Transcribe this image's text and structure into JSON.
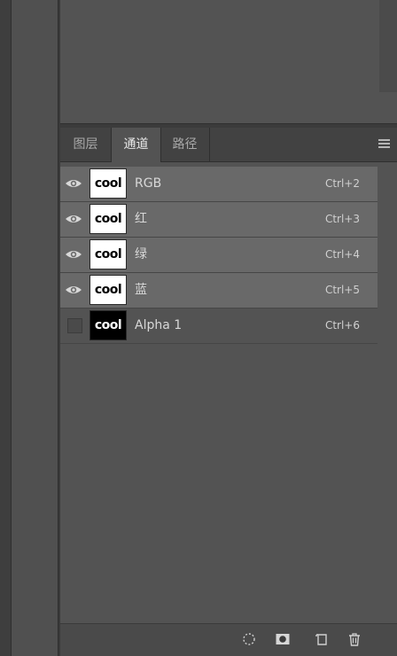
{
  "tabs": [
    {
      "label": "图层",
      "active": false
    },
    {
      "label": "通道",
      "active": true
    },
    {
      "label": "路径",
      "active": false
    }
  ],
  "channels": [
    {
      "name": "RGB",
      "shortcut": "Ctrl+2",
      "visible": true,
      "thumb_text": "cool",
      "thumb_style": "light"
    },
    {
      "name": "红",
      "shortcut": "Ctrl+3",
      "visible": true,
      "thumb_text": "cool",
      "thumb_style": "light"
    },
    {
      "name": "绿",
      "shortcut": "Ctrl+4",
      "visible": true,
      "thumb_text": "cool",
      "thumb_style": "light"
    },
    {
      "name": "蓝",
      "shortcut": "Ctrl+5",
      "visible": true,
      "thumb_text": "cool",
      "thumb_style": "light"
    },
    {
      "name": "Alpha 1",
      "shortcut": "Ctrl+6",
      "visible": false,
      "thumb_text": "cool",
      "thumb_style": "dark"
    }
  ],
  "bottom_icons": [
    "load-selection-icon",
    "save-selection-mask-icon",
    "new-channel-icon",
    "delete-icon"
  ],
  "colors": {
    "panel_bg": "#535353",
    "selected_row": "#696969",
    "tabbar_bg": "#424242"
  }
}
